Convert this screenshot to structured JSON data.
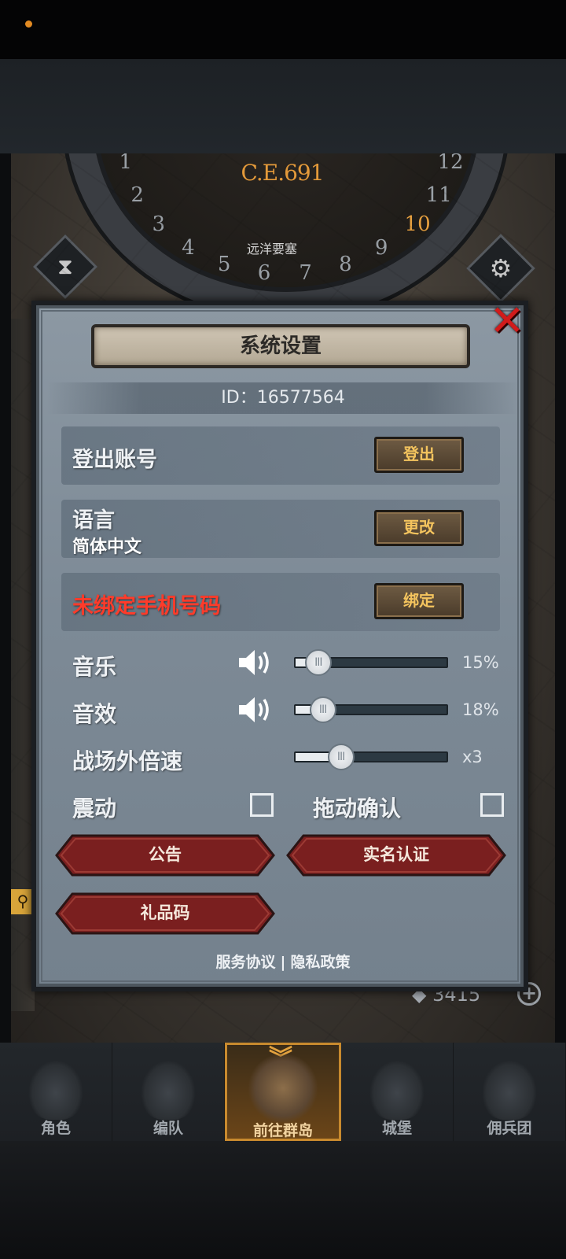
{
  "scene": {
    "era": "C.E.691",
    "dial_numbers": [
      "1",
      "2",
      "3",
      "4",
      "5",
      "6",
      "7",
      "8",
      "9",
      "10",
      "11",
      "12"
    ],
    "active_month": "10",
    "location_label": "远洋要塞",
    "currency_value": "3415"
  },
  "dialog": {
    "title": "系统设置",
    "id_text": "ID：16577564",
    "rows": [
      {
        "label": "登出账号",
        "button": "登出"
      },
      {
        "label": "语言",
        "sub": "简体中文",
        "button": "更改"
      },
      {
        "label": "未绑定手机号码",
        "button": "绑定",
        "warn_color": "#ff3b2a"
      }
    ],
    "music": {
      "label": "音乐",
      "value_text": "15%",
      "value": 0.15
    },
    "sfx": {
      "label": "音效",
      "value_text": "18%",
      "value": 0.18
    },
    "speed": {
      "label": "战场外倍速",
      "value_text": "x3",
      "value": 0.3
    },
    "vibration_label": "震动",
    "drag_confirm_label": "拖动确认",
    "buttons": {
      "notice": "公告",
      "real_name": "实名认证",
      "gift_code": "礼品码"
    },
    "footer": {
      "service": "服务协议",
      "separator": "|",
      "privacy": "隐私政策"
    }
  },
  "nav": {
    "items": [
      {
        "label": "角色",
        "icon": "knight-icon"
      },
      {
        "label": "编队",
        "icon": "team-icon"
      },
      {
        "label": "前往群岛",
        "icon": "globe-icon",
        "active": true
      },
      {
        "label": "城堡",
        "icon": "castle-icon"
      },
      {
        "label": "佣兵团",
        "icon": "mercenary-icon"
      }
    ]
  },
  "colors": {
    "accent": "#e49a3a",
    "warn": "#ff3b2a",
    "close": "#d11b1b"
  }
}
